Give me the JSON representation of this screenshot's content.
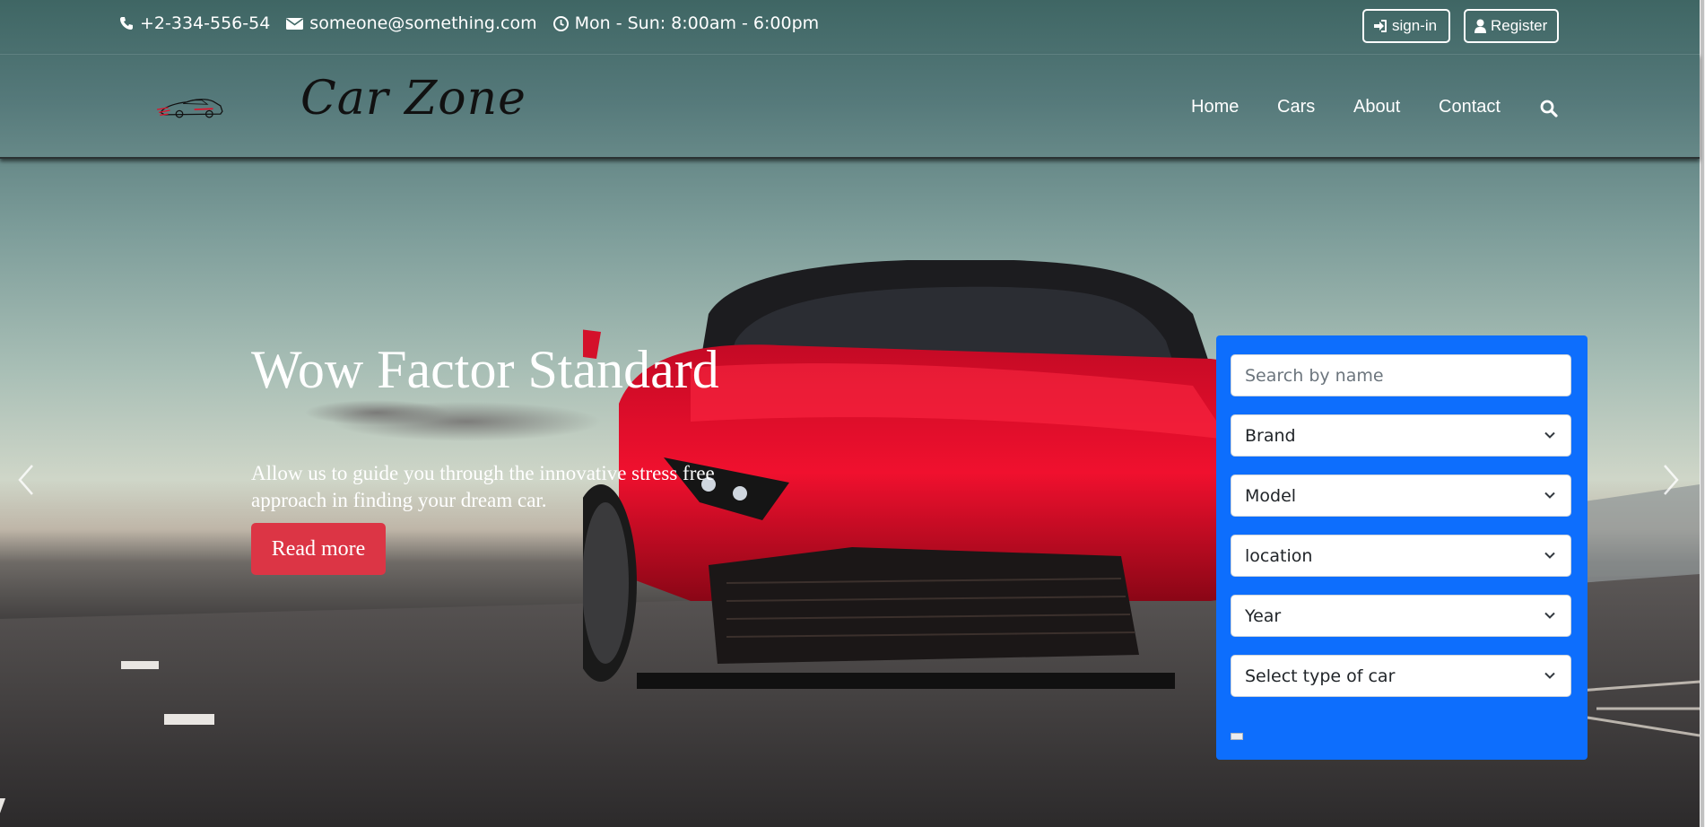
{
  "topbar": {
    "phone": "+2-334-556-54",
    "email": "someone@something.com",
    "hours": "Mon - Sun: 8:00am - 6:00pm",
    "signin_label": "sign-in",
    "register_label": "Register"
  },
  "brand": {
    "logo_text": "Car Zone"
  },
  "nav": {
    "items": [
      "Home",
      "Cars",
      "About",
      "Contact"
    ]
  },
  "hero": {
    "title": "Wow Factor Standard",
    "text": "Allow us to guide you through the innovative stress free approach in finding your dream car.",
    "button_label": "Read more"
  },
  "search_panel": {
    "name_placeholder": "Search by name",
    "brand_selected": "Brand",
    "model_selected": "Model",
    "location_selected": "location",
    "year_selected": "Year",
    "type_selected": "Select type of car"
  },
  "colors": {
    "accent_blue": "#0d6efd",
    "button_red": "#dc3545",
    "car_red": "#e0102a"
  }
}
